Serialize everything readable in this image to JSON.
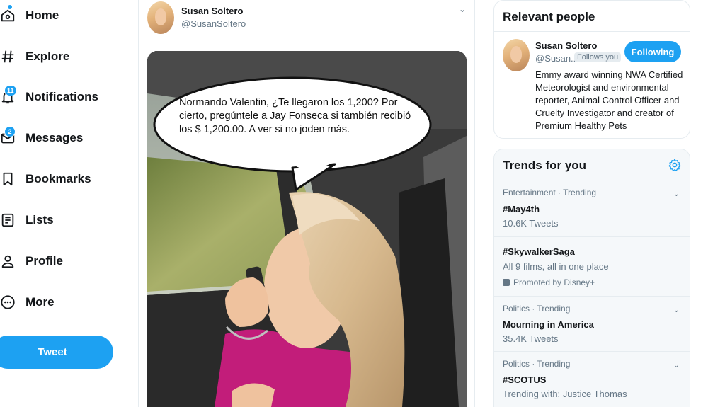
{
  "nav": {
    "items": [
      {
        "label": "Home",
        "icon": "home-icon"
      },
      {
        "label": "Explore",
        "icon": "hashtag-icon"
      },
      {
        "label": "Notifications",
        "icon": "bell-icon",
        "badge": "11"
      },
      {
        "label": "Messages",
        "icon": "envelope-icon",
        "badge": "2"
      },
      {
        "label": "Bookmarks",
        "icon": "bookmark-icon"
      },
      {
        "label": "Lists",
        "icon": "list-icon"
      },
      {
        "label": "Profile",
        "icon": "person-icon"
      },
      {
        "label": "More",
        "icon": "more-icon"
      }
    ],
    "tweet_button": "Tweet"
  },
  "tweet": {
    "author_name": "Susan Soltero",
    "author_handle": "@SusanSoltero",
    "image_caption": "Normando Valentin, ¿Te llegaron los 1,200? Por cierto, pregúntele a Jay Fonseca si también recibió los $ 1,200.00. A ver si no joden más."
  },
  "relevant_people": {
    "title": "Relevant people",
    "name": "Susan Soltero",
    "handle": "@Susan...",
    "follows_you": "Follows you",
    "following_button": "Following",
    "bio": "Emmy award winning NWA Certified Meteorologist and environmental reporter, Animal Control Officer and Cruelty Investigator and creator of Premium Healthy Pets"
  },
  "trends": {
    "title": "Trends for you",
    "items": [
      {
        "meta": "Entertainment · Trending",
        "name": "#May4th",
        "sub": "10.6K Tweets"
      },
      {
        "meta": "",
        "name": "#SkywalkerSaga",
        "sub": "All 9 films, all in one place",
        "promoted": "Promoted by Disney+"
      },
      {
        "meta": "Politics · Trending",
        "name": "Mourning in America",
        "sub": "35.4K Tweets"
      },
      {
        "meta": "Politics · Trending",
        "name": "#SCOTUS",
        "sub": "Trending with: Justice Thomas"
      }
    ]
  },
  "colors": {
    "accent": "#1da1f2",
    "text_primary": "#14171a",
    "text_secondary": "#657786",
    "border": "#e6ecf0",
    "trends_background": "#f5f8fa"
  }
}
